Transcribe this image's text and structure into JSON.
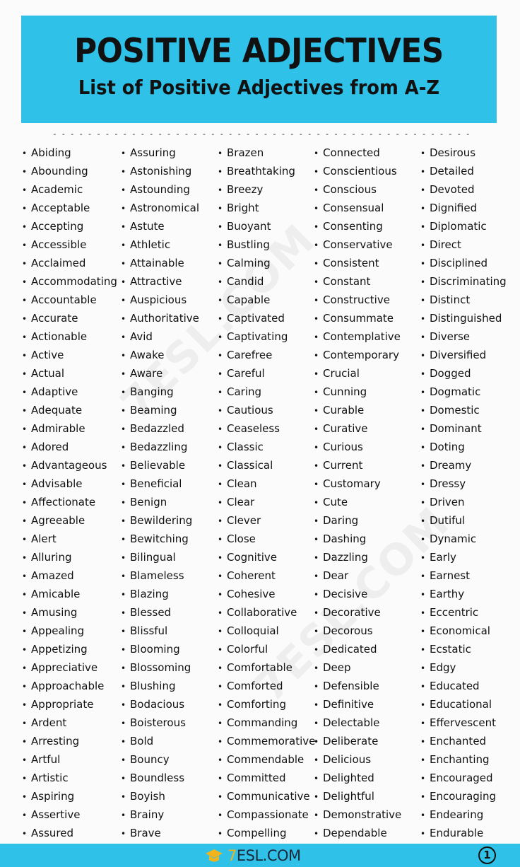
{
  "header": {
    "title": "POSITIVE ADJECTIVES",
    "subtitle": "List of Positive Adjectives from A-Z",
    "banner_color": "#2fc1e8"
  },
  "divider": "- - - - - - - - - - - - - - - - - - - - - - - - - - - - - - - - - - - - - - - - - - - - - - - - - - - - - - - - - - - - - - - - - - - - - - - - - - - -",
  "columns": [
    [
      "Abiding",
      "Abounding",
      "Academic",
      "Acceptable",
      "Accepting",
      "Accessible",
      "Acclaimed",
      "Accommodating",
      "Accountable",
      "Accurate",
      "Actionable",
      "Active",
      "Actual",
      "Adaptive",
      "Adequate",
      "Admirable",
      "Adored",
      "Advantageous",
      "Advisable",
      "Affectionate",
      "Agreeable",
      "Alert",
      "Alluring",
      "Amazed",
      "Amicable",
      "Amusing",
      "Appealing",
      "Appetizing",
      "Appreciative",
      "Approachable",
      "Appropriate",
      "Ardent",
      "Arresting",
      "Artful",
      "Artistic",
      "Aspiring",
      "Assertive",
      "Assured"
    ],
    [
      "Assuring",
      "Astonishing",
      "Astounding",
      "Astronomical",
      "Astute",
      "Athletic",
      "Attainable",
      "Attractive",
      "Auspicious",
      "Authoritative",
      "Avid",
      "Awake",
      "Aware",
      "Banging",
      "Beaming",
      "Bedazzled",
      "Bedazzling",
      "Believable",
      "Beneficial",
      "Benign",
      "Bewildering",
      "Bewitching",
      "Bilingual",
      "Blameless",
      "Blazing",
      "Blessed",
      "Blissful",
      "Blooming",
      "Blossoming",
      "Blushing",
      "Bodacious",
      "Boisterous",
      "Bold",
      "Bouncy",
      "Boundless",
      "Boyish",
      "Brainy",
      "Brave"
    ],
    [
      "Brazen",
      "Breathtaking",
      "Breezy",
      "Bright",
      "Buoyant",
      "Bustling",
      "Calming",
      "Candid",
      "Capable",
      "Captivated",
      "Captivating",
      "Carefree",
      "Careful",
      "Caring",
      "Cautious",
      "Ceaseless",
      "Classic",
      "Classical",
      "Clean",
      "Clear",
      "Clever",
      "Close",
      "Cognitive",
      "Coherent",
      "Cohesive",
      "Collaborative",
      "Colloquial",
      "Colorful",
      "Comfortable",
      "Comforted",
      "Comforting",
      "Commanding",
      "Commemorative",
      "Commendable",
      "Committed",
      "Communicative",
      "Compassionate",
      "Compelling"
    ],
    [
      "Connected",
      "Conscientious",
      "Conscious",
      "Consensual",
      "Consenting",
      "Conservative",
      "Consistent",
      "Constant",
      "Constructive",
      "Consummate",
      "Contemplative",
      "Contemporary",
      "Crucial",
      "Cunning",
      "Curable",
      "Curative",
      "Curious",
      "Current",
      "Customary",
      "Cute",
      "Daring",
      "Dashing",
      "Dazzling",
      "Dear",
      "Decisive",
      "Decorative",
      "Decorous",
      "Dedicated",
      "Deep",
      "Defensible",
      "Definitive",
      "Delectable",
      "Deliberate",
      "Delicious",
      "Delighted",
      "Delightful",
      "Demonstrative",
      "Dependable"
    ],
    [
      "Desirous",
      "Detailed",
      "Devoted",
      "Dignified",
      "Diplomatic",
      "Direct",
      "Disciplined",
      "Discriminating",
      "Distinct",
      "Distinguished",
      "Diverse",
      "Diversified",
      "Dogged",
      "Dogmatic",
      "Domestic",
      "Dominant",
      "Doting",
      "Dreamy",
      "Dressy",
      "Driven",
      "Dutiful",
      "Dynamic",
      "Early",
      "Earnest",
      "Earthy",
      "Eccentric",
      "Economical",
      "Ecstatic",
      "Edgy",
      "Educated",
      "Educational",
      "Effervescent",
      "Enchanted",
      "Enchanting",
      "Encouraged",
      "Encouraging",
      "Endearing",
      "Endurable"
    ]
  ],
  "bullet": "•",
  "watermark": "7ESL.COM",
  "footer": {
    "logo_prefix": "7",
    "logo_text": "ESL.COM",
    "logo_icon": "graduation-cap-icon",
    "page_number": "1",
    "accent_color": "#f3b41b"
  }
}
